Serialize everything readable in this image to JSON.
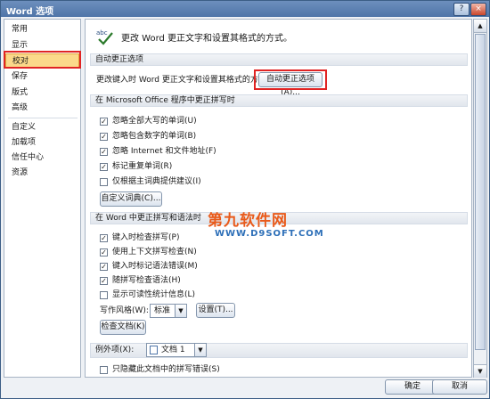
{
  "window": {
    "title": "Word 选项",
    "minimize": "?",
    "close": "×"
  },
  "sidebar": {
    "items": [
      {
        "label": "常用"
      },
      {
        "label": "显示"
      },
      {
        "label": "校对"
      },
      {
        "label": "保存"
      },
      {
        "label": "版式"
      },
      {
        "label": "高级"
      },
      {
        "label": "自定义"
      },
      {
        "label": "加载项"
      },
      {
        "label": "信任中心"
      },
      {
        "label": "资源"
      }
    ],
    "selected": "校对"
  },
  "header": {
    "text": "更改 Word 更正文字和设置其格式的方式。",
    "icon": "check-abc-icon"
  },
  "autocorrect": {
    "section_title": "自动更正选项",
    "desc": "更改键入时 Word 更正文字和设置其格式的方式:",
    "button": "自动更正选项(A)..."
  },
  "office_spelling": {
    "section_title": "在 Microsoft Office 程序中更正拼写时",
    "options": [
      {
        "label": "忽略全部大写的单词(U)",
        "checked": true
      },
      {
        "label": "忽略包含数字的单词(B)",
        "checked": true
      },
      {
        "label": "忽略 Internet 和文件地址(F)",
        "checked": true
      },
      {
        "label": "标记重复单词(R)",
        "checked": true
      },
      {
        "label": "仅根据主词典提供建议(I)",
        "checked": false
      }
    ],
    "custom_dict_button": "自定义词典(C)..."
  },
  "word_spelling": {
    "section_title": "在 Word 中更正拼写和语法时",
    "options": [
      {
        "label": "键入时检查拼写(P)",
        "checked": true
      },
      {
        "label": "使用上下文拼写检查(N)",
        "checked": true
      },
      {
        "label": "键入时标记语法错误(M)",
        "checked": true
      },
      {
        "label": "随拼写检查语法(H)",
        "checked": true
      },
      {
        "label": "显示可读性统计信息(L)",
        "checked": false
      }
    ],
    "writing_style_label": "写作风格(W):",
    "writing_style_value": "标准",
    "settings_button": "设置(T)...",
    "check_document_button": "检查文档(K)"
  },
  "exceptions": {
    "label": "例外项(X):",
    "value": "文档 1",
    "options": [
      {
        "label": "只隐藏此文档中的拼写错误(S)",
        "checked": false
      }
    ]
  },
  "footer": {
    "ok": "确定",
    "cancel": "取消"
  },
  "watermark": {
    "title": "第九软件网",
    "url": "WWW.D9SOFT.COM"
  },
  "colors": {
    "accent": "#4f75a8",
    "highlight": "#e02424",
    "selected_nav": "#fbd98a"
  }
}
